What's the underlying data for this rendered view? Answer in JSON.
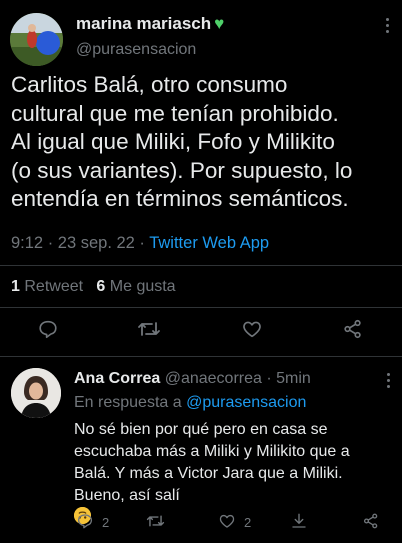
{
  "tweet": {
    "author_name": "marina mariasch",
    "author_handle": "@purasensacion",
    "text_lines": [
      "Carlitos Balá, otro consumo",
      "cultural que me tenían prohibido.",
      "Al igual que Miliki, Fofo y Milikito",
      "(o sus variantes). Por supuesto, lo",
      "entendía en términos semánticos."
    ],
    "time": "9:12 · 23 sep. 22 ·",
    "app": "Twitter Web App",
    "retweets_count": "1",
    "retweets_label": "Retweet",
    "likes_count": "6",
    "likes_label": "Me gusta"
  },
  "reply": {
    "author_name": "Ana Correa",
    "author_handle": "@anaecorrea",
    "time": "· 5min",
    "in_reply_prefix": "En respuesta a",
    "in_reply_handle": "@purasensacion",
    "text_lines": [
      "No sé bien por qué pero en casa se",
      "escuchaba más a Miliki y Milikito que a",
      "Balá. Y más a Victor Jara que a Miliki.",
      "Bueno, así salí"
    ],
    "reply_count": "2",
    "like_count": "2"
  },
  "colors": {
    "background": "#000000",
    "text": "#e7e9ea",
    "secondary": "#71767b",
    "link": "#1d9bf0",
    "separator": "#2f3336",
    "verified_heart": "#4fd06a"
  }
}
